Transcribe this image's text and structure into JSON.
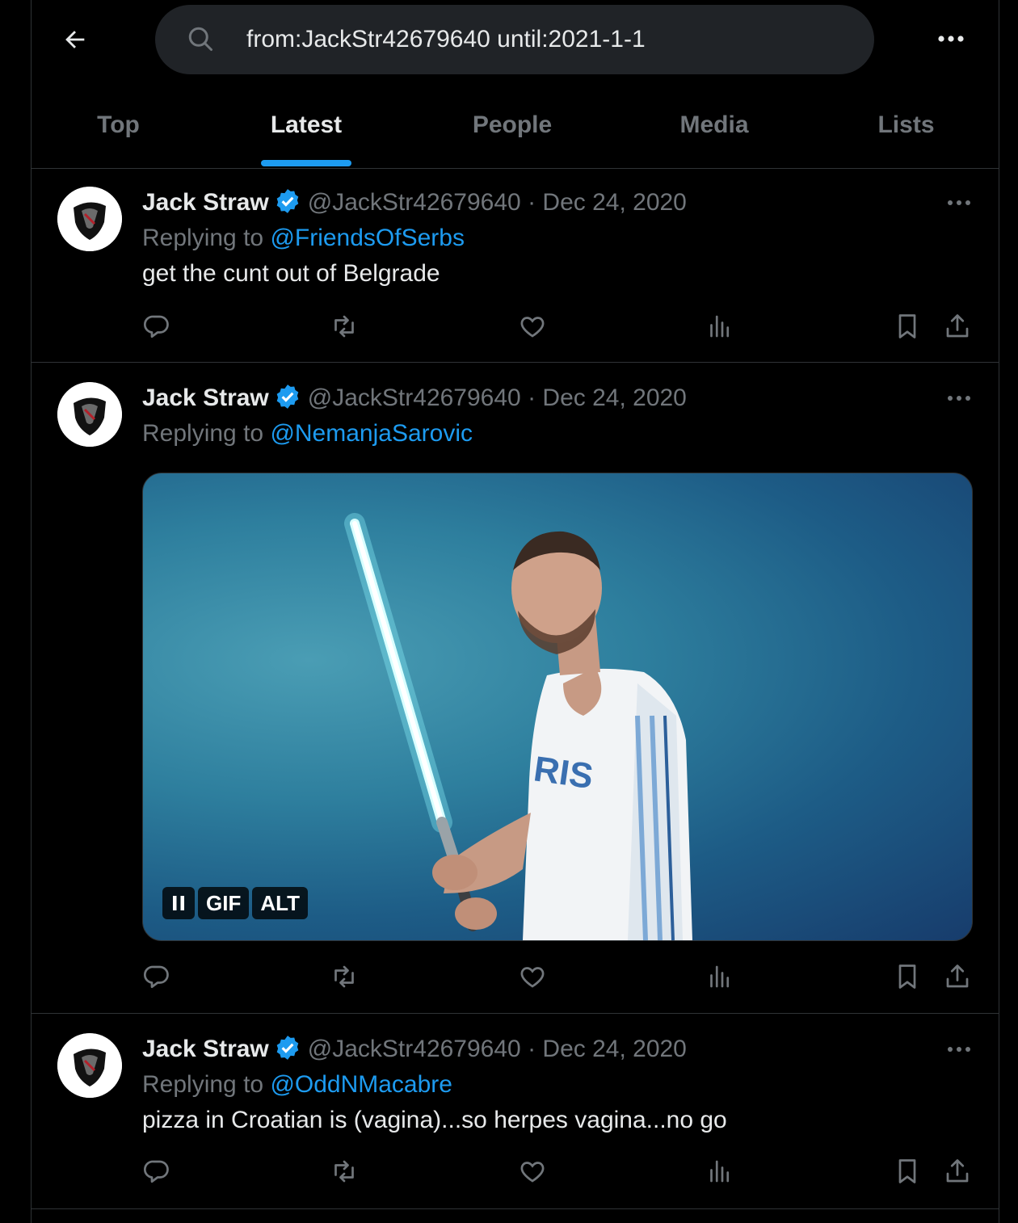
{
  "search": {
    "query": "from:JackStr42679640 until:2021-1-1"
  },
  "tabs": [
    {
      "label": "Top"
    },
    {
      "label": "Latest"
    },
    {
      "label": "People"
    },
    {
      "label": "Media"
    },
    {
      "label": "Lists"
    }
  ],
  "active_tab": "Latest",
  "accent_color": "#1d9bf0",
  "tweets": [
    {
      "name": "Jack Straw",
      "handle": "@JackStr42679640",
      "date": "Dec 24, 2020",
      "replying_prefix": "Replying to",
      "replying_to": "@FriendsOfSerbs",
      "text": "get the cunt out of Belgrade"
    },
    {
      "name": "Jack Straw",
      "handle": "@JackStr42679640",
      "date": "Dec 24, 2020",
      "replying_prefix": "Replying to",
      "replying_to": "@NemanjaSarovic",
      "media": {
        "gif_label": "GIF",
        "alt_label": "ALT",
        "jersey_text": "RIS"
      }
    },
    {
      "name": "Jack Straw",
      "handle": "@JackStr42679640",
      "date": "Dec 24, 2020",
      "replying_prefix": "Replying to",
      "replying_to": "@OddNMacabre",
      "text": "pizza in Croatian is (vagina)...so herpes vagina...no go"
    }
  ]
}
